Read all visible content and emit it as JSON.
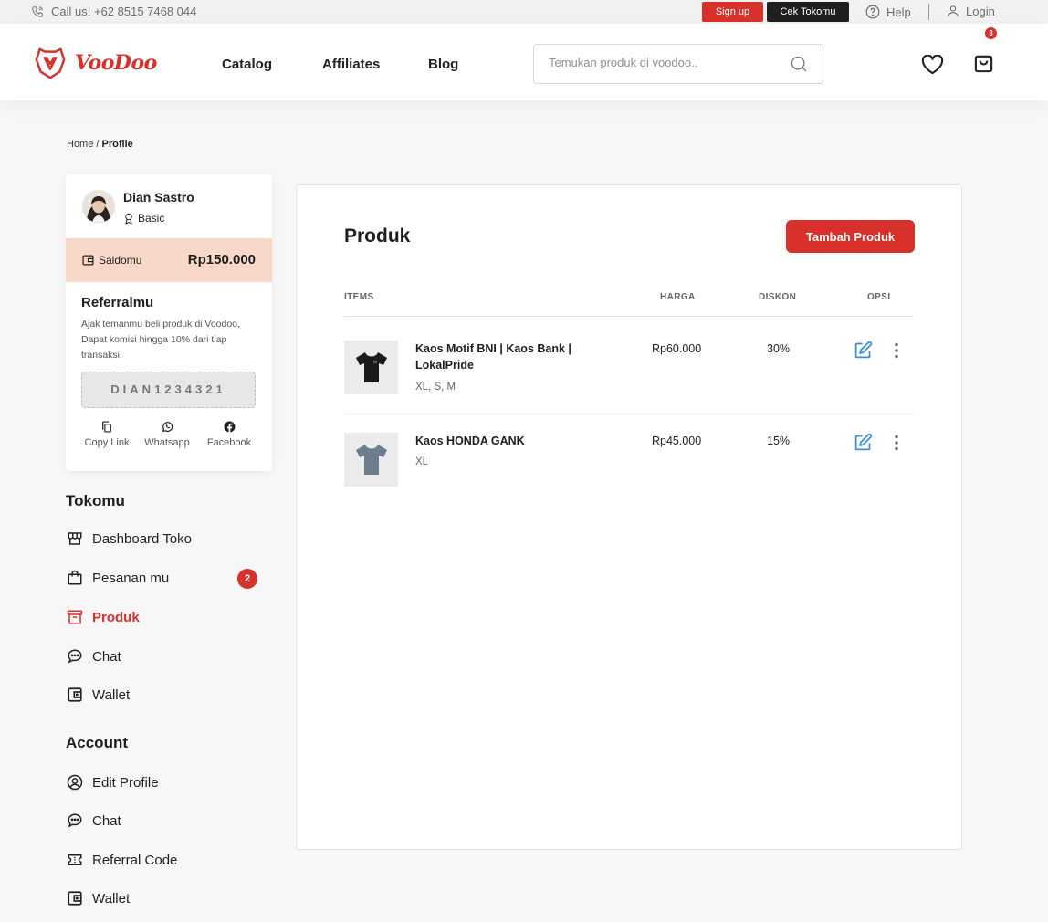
{
  "topbar": {
    "call": "Call us! +62 8515 7468 044",
    "signup": "Sign up",
    "cek_tokomu": "Cek Tokomu",
    "help": "Help",
    "login": "Login"
  },
  "header": {
    "brand": "VooDoo",
    "nav": [
      "Catalog",
      "Affiliates",
      "Blog"
    ],
    "search_placeholder": "Temukan produk di voodoo..",
    "cart_count": "3"
  },
  "breadcrumb": {
    "home": "Home",
    "separator": "/",
    "current": "Profile"
  },
  "profile": {
    "name": "Dian Sastro",
    "tier": "Basic",
    "saldo_label": "Saldomu",
    "saldo_value": "Rp150.000",
    "referral_title": "Referralmu",
    "referral_desc": "Ajak temanmu beli produk di Voodoo, Dapat komisi hingga 10% dari tiap transaksi.",
    "referral_code": "DIAN1234321",
    "share": [
      "Copy Link",
      "Whatsapp",
      "Facebook"
    ]
  },
  "sidebar": {
    "tokomu_title": "Tokomu",
    "tokomu_items": [
      "Dashboard Toko",
      "Pesanan mu",
      "Produk",
      "Chat",
      "Wallet"
    ],
    "pesanan_badge": "2",
    "account_title": "Account",
    "account_items": [
      "Edit Profile",
      "Chat",
      "Referral Code",
      "Wallet"
    ]
  },
  "main": {
    "title": "Produk",
    "add_button": "Tambah Produk",
    "columns": [
      "ITEMS",
      "HARGA",
      "DISKON",
      "OPSI"
    ],
    "products": [
      {
        "name": "Kaos Motif BNI | Kaos Bank | LokalPride",
        "sizes": "XL, S, M",
        "price": "Rp60.000",
        "discount": "30%"
      },
      {
        "name": "Kaos HONDA GANK",
        "sizes": "XL",
        "price": "Rp45.000",
        "discount": "15%"
      }
    ]
  },
  "colors": {
    "accent": "#d8312c",
    "saldo_bg": "#f8d8c8",
    "edit_icon": "#3a8fd6",
    "shirt_black": "#1b1b1b",
    "shirt_grey": "#6e7d8d"
  }
}
